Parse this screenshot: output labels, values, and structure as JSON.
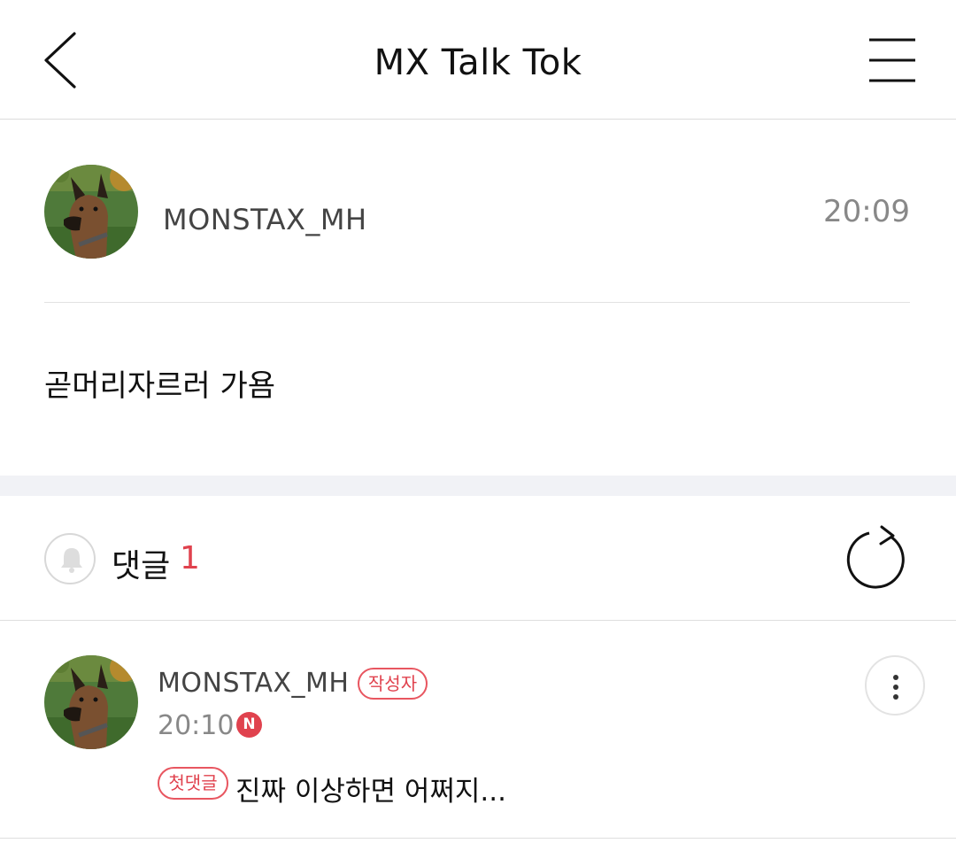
{
  "header": {
    "title": "MX Talk Tok",
    "back_icon": "chevron-left-icon",
    "menu_icon": "hamburger-menu-icon"
  },
  "post": {
    "author": "MONSTAX_MH",
    "time": "20:09",
    "body": "곧머리자르러 가욤"
  },
  "comments_section": {
    "label": "댓글",
    "count": "1",
    "count_color": "#e0424e",
    "bell_icon": "bell-icon",
    "refresh_icon": "refresh-icon"
  },
  "comments": [
    {
      "author": "MONSTAX_MH",
      "author_badge": "작성자",
      "time": "20:10",
      "new_badge": "N",
      "first_badge": "첫댓글",
      "text": "진짜 이상하면 어쩌지...",
      "more_icon": "more-vertical-icon"
    }
  ],
  "colors": {
    "accent": "#e0424e",
    "band": "#f1f2f6"
  }
}
